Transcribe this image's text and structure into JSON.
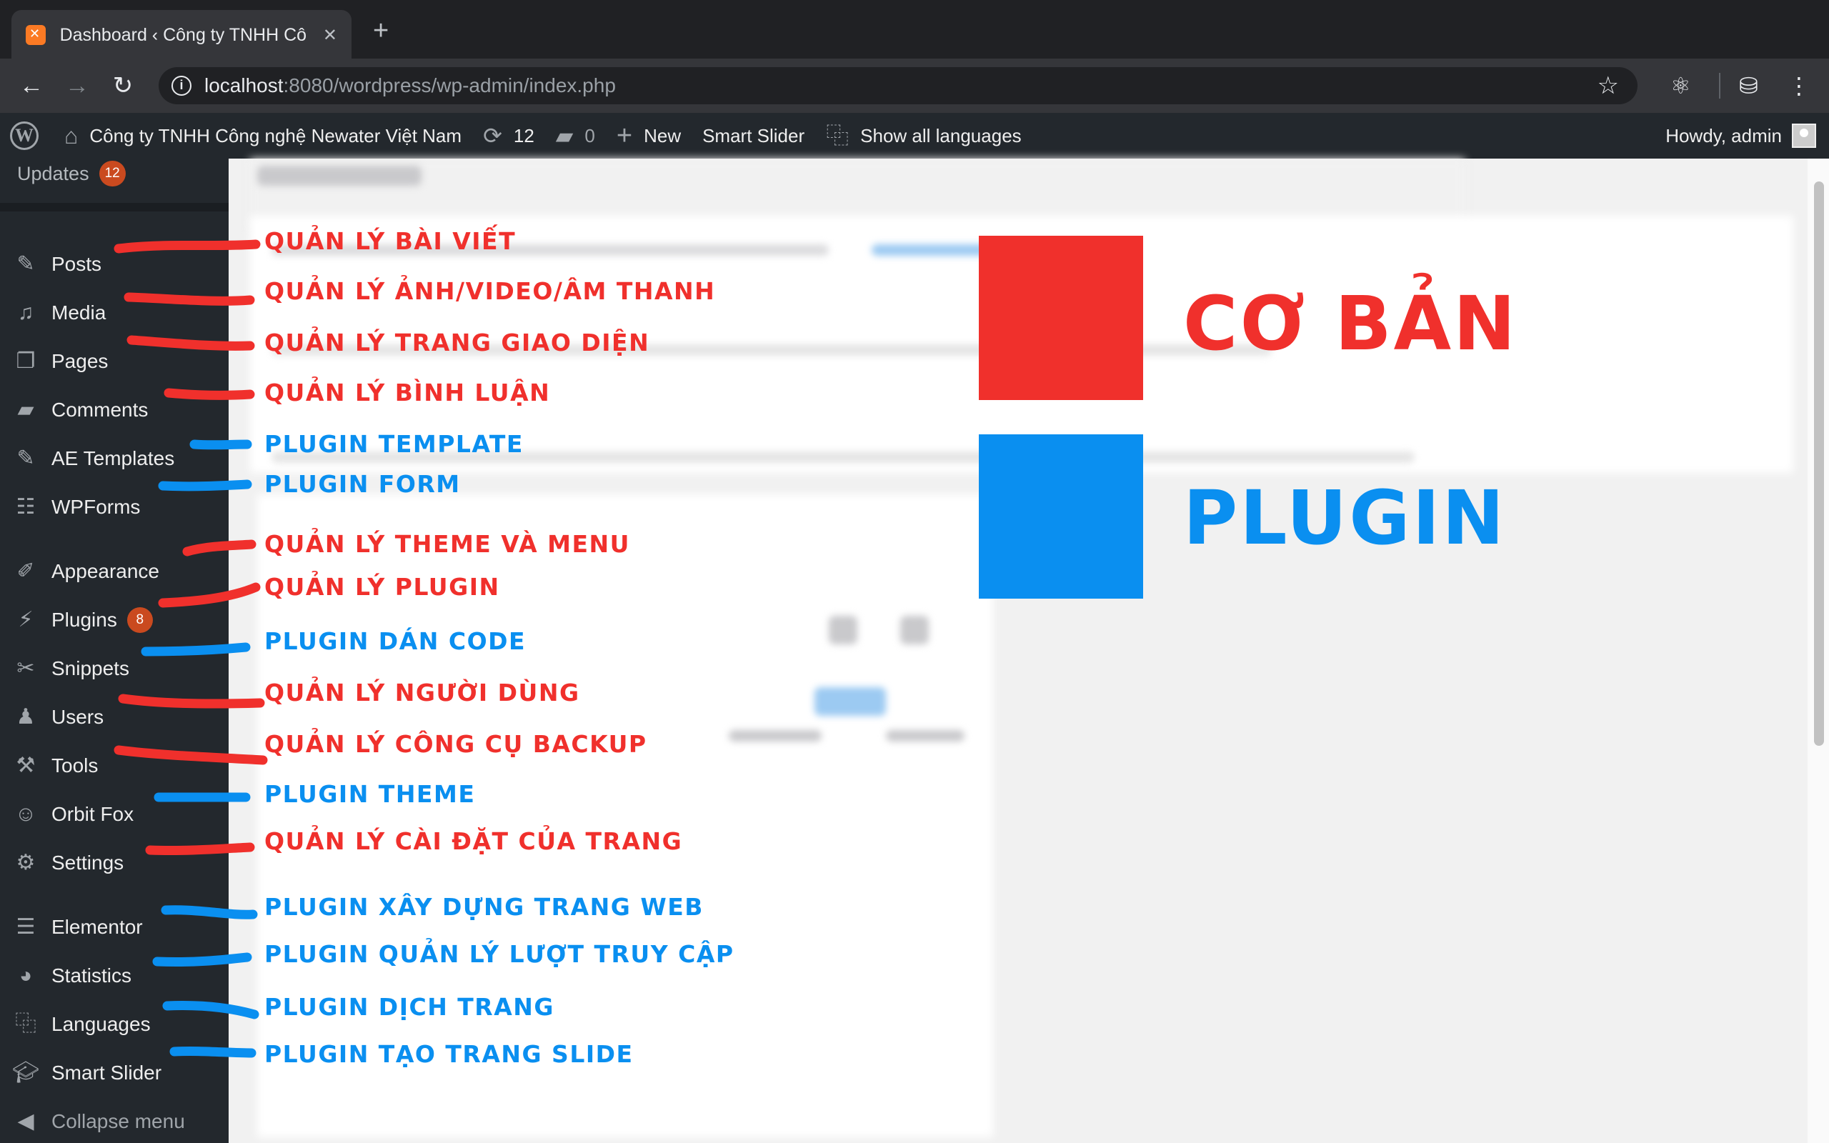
{
  "browser": {
    "tab_title": "Dashboard ‹ Công ty TNHH Cô",
    "new_tab": "+",
    "url_host": "localhost",
    "url_rest": ":8080/wordpress/wp-admin/index.php"
  },
  "adminbar": {
    "site_name": "Công ty TNHH Công nghệ Newater Việt Nam",
    "updates_count": "12",
    "comments_count": "0",
    "new_label": "New",
    "smart_slider": "Smart Slider",
    "show_languages": "Show all languages",
    "howdy": "Howdy, admin"
  },
  "sidebar": {
    "updates_label": "Updates",
    "updates_badge": "12",
    "items": [
      {
        "label": "Posts",
        "icon": "pin-icon"
      },
      {
        "label": "Media",
        "icon": "media-icon"
      },
      {
        "label": "Pages",
        "icon": "pages-icon"
      },
      {
        "label": "Comments",
        "icon": "comment-icon"
      },
      {
        "label": "AE Templates",
        "icon": "pin-icon"
      },
      {
        "label": "WPForms",
        "icon": "form-icon"
      },
      {
        "label": "Appearance",
        "icon": "brush-icon"
      },
      {
        "label": "Plugins",
        "icon": "plugin-icon",
        "badge": "8"
      },
      {
        "label": "Snippets",
        "icon": "scissors-icon"
      },
      {
        "label": "Users",
        "icon": "user-icon"
      },
      {
        "label": "Tools",
        "icon": "wrench-icon"
      },
      {
        "label": "Orbit Fox",
        "icon": "fox-icon"
      },
      {
        "label": "Settings",
        "icon": "settings-icon"
      },
      {
        "label": "Elementor",
        "icon": "elementor-icon"
      },
      {
        "label": "Statistics",
        "icon": "pie-icon"
      },
      {
        "label": "Languages",
        "icon": "translate-icon"
      },
      {
        "label": "Smart Slider",
        "icon": "mortarboard-icon"
      }
    ],
    "collapse_label": "Collapse menu"
  },
  "annotations": [
    {
      "text": "QUẢN LÝ BÀI VIẾT",
      "color": "#f0302c"
    },
    {
      "text": "QUẢN LÝ ẢNH/VIDEO/ÂM THANH",
      "color": "#f0302c"
    },
    {
      "text": "QUẢN LÝ TRANG GIAO DIỆN",
      "color": "#f0302c"
    },
    {
      "text": "QUẢN LÝ BÌNH LUẬN",
      "color": "#f0302c"
    },
    {
      "text": "PLUGIN TEMPLATE",
      "color": "#0a8ff0"
    },
    {
      "text": "PLUGIN FORM",
      "color": "#0a8ff0"
    },
    {
      "text": "QUẢN LÝ THEME VÀ MENU",
      "color": "#f0302c"
    },
    {
      "text": "QUẢN LÝ PLUGIN",
      "color": "#f0302c"
    },
    {
      "text": "PLUGIN DÁN CODE",
      "color": "#0a8ff0"
    },
    {
      "text": "QUẢN LÝ NGƯỜI DÙNG",
      "color": "#f0302c"
    },
    {
      "text": "QUẢN LÝ CÔNG CỤ BACKUP",
      "color": "#f0302c"
    },
    {
      "text": "PLUGIN THEME",
      "color": "#0a8ff0"
    },
    {
      "text": "QUẢN LÝ CÀI ĐẶT CỦA TRANG",
      "color": "#f0302c"
    },
    {
      "text": "PLUGIN XÂY DỰNG TRANG WEB",
      "color": "#0a8ff0"
    },
    {
      "text": "PLUGIN QUẢN LÝ LƯỢT TRUY CẬP",
      "color": "#0a8ff0"
    },
    {
      "text": "PLUGIN DỊCH TRANG",
      "color": "#0a8ff0"
    },
    {
      "text": "PLUGIN TẠO TRANG SLIDE",
      "color": "#0a8ff0"
    }
  ],
  "legend": {
    "basic_label": "CƠ BẢN",
    "basic_color": "#f0302c",
    "plugin_label": "PLUGIN",
    "plugin_color": "#0a8ff0"
  }
}
